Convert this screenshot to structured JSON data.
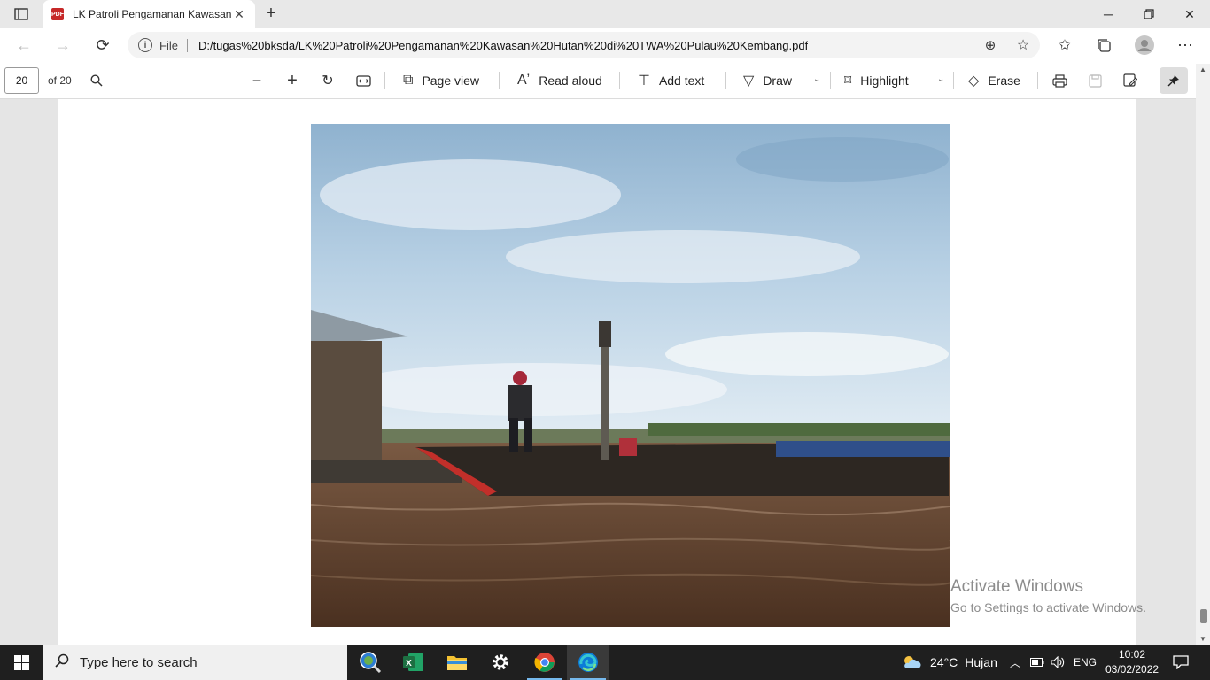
{
  "browser": {
    "tab_title": "LK Patroli Pengamanan Kawasan",
    "tab_favicon_text": "PDF",
    "address_scheme": "File",
    "url": "D:/tugas%20bksda/LK%20Patroli%20Pengamanan%20Kawasan%20Hutan%20di%20TWA%20Pulau%20Kembang.pdf"
  },
  "pdf_toolbar": {
    "page_number": "20",
    "page_of": "of 20",
    "page_view": "Page view",
    "read_aloud": "Read aloud",
    "add_text": "Add text",
    "draw": "Draw",
    "highlight": "Highlight",
    "erase": "Erase"
  },
  "watermark": {
    "line1": "Activate Windows",
    "line2": "Go to Settings to activate Windows."
  },
  "taskbar": {
    "search_placeholder": "Type here to search",
    "weather_temp": "24°C",
    "weather_desc": "Hujan",
    "language": "ENG",
    "time": "10:02",
    "date": "03/02/2022"
  },
  "colors": {
    "accent": "#76b9ed",
    "pdf_red": "#c62828",
    "excel_green": "#1d6f42"
  }
}
